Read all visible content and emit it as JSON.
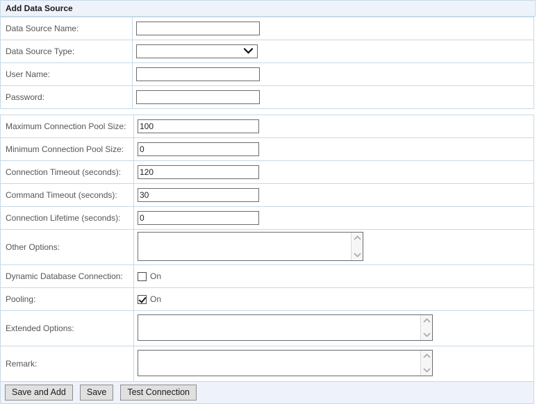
{
  "panel": {
    "title": "Add Data Source"
  },
  "groups": [
    {
      "name": "connection-identity",
      "rows": [
        {
          "label": "Data Source Name:",
          "control": "text",
          "name": "data-source-name",
          "value": "",
          "placeholder": ""
        },
        {
          "label": "Data Source Type:",
          "control": "select",
          "name": "data-source-type",
          "value": "",
          "options": [
            ""
          ]
        },
        {
          "label": "User Name:",
          "control": "text",
          "name": "user-name",
          "value": "",
          "placeholder": ""
        },
        {
          "label": "Password:",
          "control": "text",
          "name": "password",
          "value": "",
          "placeholder": ""
        }
      ]
    },
    {
      "name": "connection-settings",
      "rows": [
        {
          "label": "Maximum Connection Pool Size:",
          "control": "text",
          "name": "max-connection-pool-size",
          "value": "100",
          "placeholder": ""
        },
        {
          "label": "Minimum Connection Pool Size:",
          "control": "text",
          "name": "min-connection-pool-size",
          "value": "0",
          "placeholder": ""
        },
        {
          "label": "Connection Timeout (seconds):",
          "control": "text",
          "name": "connection-timeout",
          "value": "120",
          "placeholder": ""
        },
        {
          "label": "Command Timeout (seconds):",
          "control": "text",
          "name": "command-timeout",
          "value": "30",
          "placeholder": ""
        },
        {
          "label": "Connection Lifetime (seconds):",
          "control": "text",
          "name": "connection-lifetime",
          "value": "0",
          "placeholder": ""
        },
        {
          "label": "Other Options:",
          "control": "textarea",
          "name": "other-options",
          "value": "",
          "placeholder": ""
        },
        {
          "label": "Dynamic Database Connection:",
          "control": "checkbox",
          "name": "dynamic-database-connection",
          "checked": false,
          "checkbox_label": "On"
        },
        {
          "label": "Pooling:",
          "control": "checkbox",
          "name": "pooling",
          "checked": true,
          "checkbox_label": "On"
        },
        {
          "label": "Extended Options:",
          "control": "textarea",
          "name": "extended-options",
          "value": "",
          "placeholder": ""
        },
        {
          "label": "Remark:",
          "control": "textarea",
          "name": "remark",
          "value": "",
          "placeholder": ""
        }
      ]
    }
  ],
  "footer": {
    "buttons": [
      {
        "name": "save-and-add-button",
        "label": "Save and Add"
      },
      {
        "name": "save-button",
        "label": "Save"
      },
      {
        "name": "test-connection-button",
        "label": "Test Connection"
      }
    ]
  },
  "icons": {
    "chevron_down": "chevron-down-icon",
    "scroll_up": "scroll-up-arrow-icon",
    "scroll_down": "scroll-down-arrow-icon",
    "checkbox_check": "check-mark-icon"
  },
  "colors": {
    "panel_header_bg": "#eef3fb",
    "panel_border": "#c6d9e6",
    "label_text": "#555555",
    "field_border": "#6b6b6b",
    "button_bg": "#e0e0e0"
  }
}
